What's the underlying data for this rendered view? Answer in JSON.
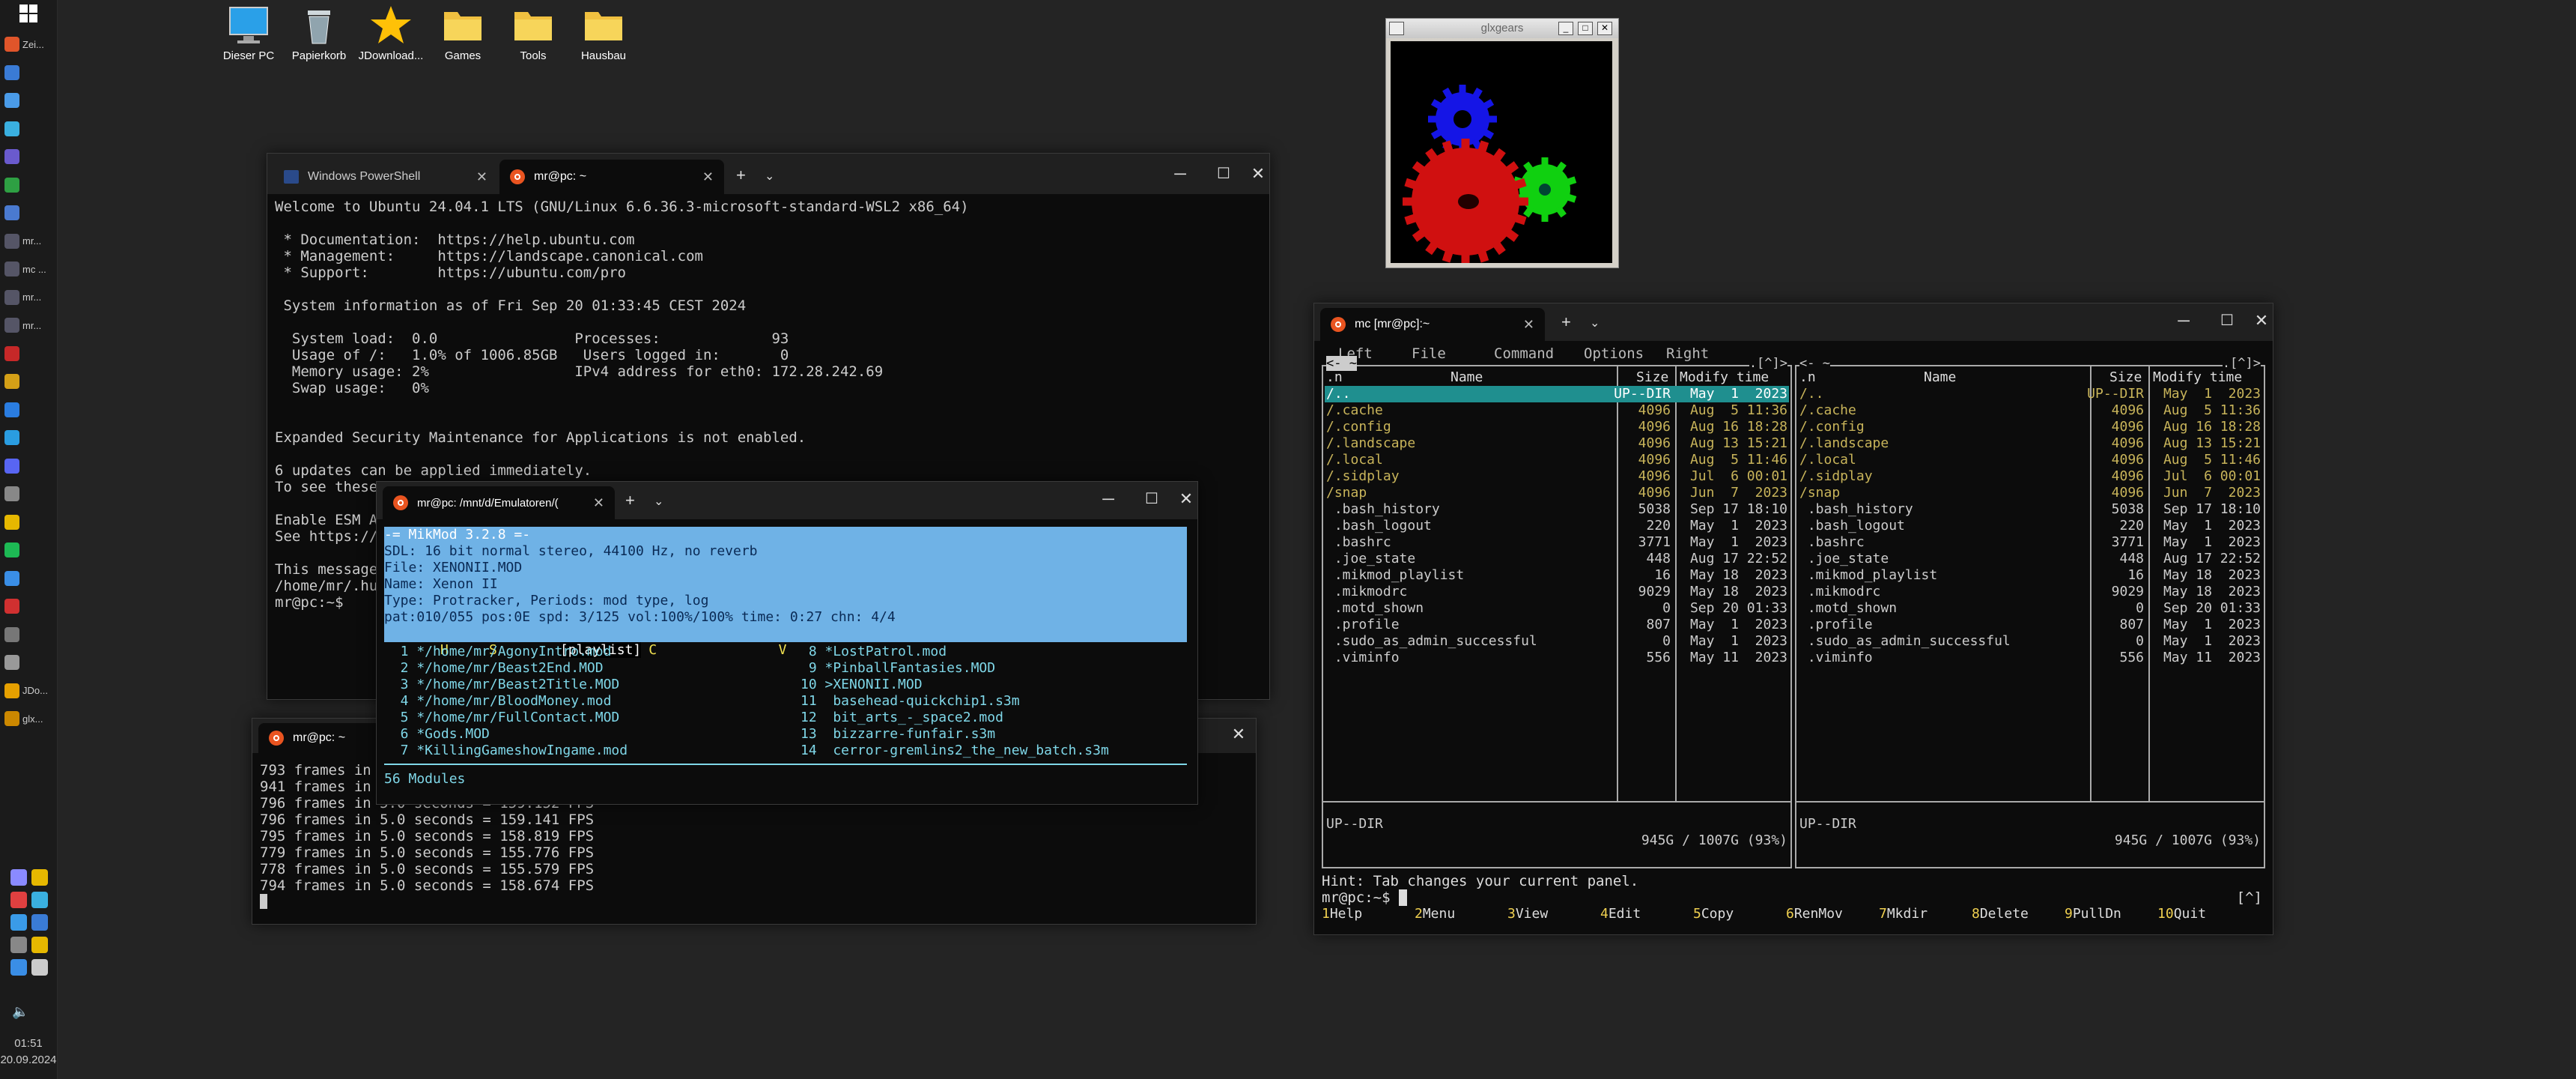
{
  "taskbar": {
    "items": [
      {
        "label": "Zei...",
        "color": "#e0552a"
      },
      {
        "label": "",
        "color": "#3a7bd5"
      },
      {
        "label": "",
        "color": "#4a9be8"
      },
      {
        "label": "",
        "color": "#3ab0e0"
      },
      {
        "label": "",
        "color": "#6a5acd"
      },
      {
        "label": "",
        "color": "#2ea043"
      },
      {
        "label": "",
        "color": "#4a7ad0"
      },
      {
        "label": "mr...",
        "color": "#556"
      },
      {
        "label": "mc ...",
        "color": "#556"
      },
      {
        "label": "mr...",
        "color": "#556"
      },
      {
        "label": "mr...",
        "color": "#556"
      },
      {
        "label": "",
        "color": "#c62828"
      },
      {
        "label": "",
        "color": "#d4a017"
      },
      {
        "label": "",
        "color": "#2a7de1"
      },
      {
        "label": "",
        "color": "#2a9de1"
      },
      {
        "label": "",
        "color": "#5865f2"
      },
      {
        "label": "",
        "color": "#888"
      },
      {
        "label": "",
        "color": "#e6b800"
      },
      {
        "label": "",
        "color": "#1db954"
      },
      {
        "label": "",
        "color": "#3a8ee6"
      },
      {
        "label": "",
        "color": "#d03030"
      },
      {
        "label": "",
        "color": "#777"
      },
      {
        "label": "",
        "color": "#999"
      },
      {
        "label": "JDo...",
        "color": "#e6a000"
      },
      {
        "label": "glx...",
        "color": "#cc8800"
      }
    ],
    "clock_time": "01:51",
    "clock_date": "20.09.2024"
  },
  "desktop_icons": [
    {
      "label": "Dieser PC",
      "icon": "monitor-icon"
    },
    {
      "label": "Papierkorb",
      "icon": "recycle-bin-icon"
    },
    {
      "label": "JDownload...",
      "icon": "star-icon"
    },
    {
      "label": "Games",
      "icon": "folder-icon"
    },
    {
      "label": "Tools",
      "icon": "folder-icon"
    },
    {
      "label": "Hausbau",
      "icon": "folder-icon"
    }
  ],
  "glxgears": {
    "title": "glxgears",
    "min": "_",
    "max": "□",
    "close": "✕"
  },
  "term1": {
    "tab1": "Windows PowerShell",
    "tab2": "mr@pc: ~",
    "lines": [
      "Welcome to Ubuntu 24.04.1 LTS (GNU/Linux 6.6.36.3-microsoft-standard-WSL2 x86_64)",
      "",
      " * Documentation:  https://help.ubuntu.com",
      " * Management:     https://landscape.canonical.com",
      " * Support:        https://ubuntu.com/pro",
      "",
      " System information as of Fri Sep 20 01:33:45 CEST 2024",
      "",
      "  System load:  0.0                Processes:             93",
      "  Usage of /:   1.0% of 1006.85GB   Users logged in:       0",
      "  Memory usage: 2%                 IPv4 address for eth0: 172.28.242.69",
      "  Swap usage:   0%",
      "",
      "",
      "Expanded Security Maintenance for Applications is not enabled.",
      "",
      "6 updates can be applied immediately.",
      "To see these",
      "",
      "Enable ESM Ap",
      "See https://u",
      "",
      "This message",
      "/home/mr/.hus",
      "mr@pc:~$"
    ]
  },
  "term2": {
    "tab": "mr@pc: ~",
    "lines": [
      "793 frames in 5",
      "941 frames in 5",
      "796 frames in 5.0 seconds = 159.152 FPS",
      "796 frames in 5.0 seconds = 159.141 FPS",
      "795 frames in 5.0 seconds = 158.819 FPS",
      "779 frames in 5.0 seconds = 155.776 FPS",
      "778 frames in 5.0 seconds = 155.579 FPS",
      "794 frames in 5.0 seconds = 158.674 FPS"
    ]
  },
  "mikmod": {
    "tab": "mr@pc: /mnt/d/Emulatoren/(",
    "header_lines": [
      "-= MikMod 3.2.8 =-",
      "SDL: 16 bit normal stereo, 44100 Hz, no reverb",
      "File: XENONII.MOD",
      "Name: Xenon II",
      "Type: Protracker, Periods: mod type, log",
      "pat:010/055 pos:0E spd: 3/125 vol:100%/100% time: 0:27 chn: 4/4"
    ],
    "menu_left": "H     S",
    "menu_active": "[playlist]",
    "menu_right": "C               V",
    "playlist_left": [
      "  1 */home/mr/AgonyIntro.mod",
      "  2 */home/mr/Beast2End.MOD",
      "  3 */home/mr/Beast2Title.MOD",
      "  4 */home/mr/BloodMoney.mod",
      "  5 */home/mr/FullContact.MOD",
      "  6 *Gods.MOD",
      "  7 *KillingGameshowIngame.mod"
    ],
    "playlist_right": [
      " 8 *LostPatrol.mod",
      " 9 *PinballFantasies.MOD",
      "10 >XENONII.MOD",
      "11  basehead-quickchip1.s3m",
      "12  bit_arts_-_space2.mod",
      "13  bizzarre-funfair.s3m",
      "14  cerror-gremlins2_the_new_batch.s3m"
    ],
    "footer": "56 Modules"
  },
  "mc": {
    "tab": "mc [mr@pc]:~",
    "menu": [
      "Left",
      "File",
      "Command",
      "Options",
      "Right"
    ],
    "left_path": "<- ~ ",
    "right_path": "<- ~ ",
    "corner": ".[^]>",
    "headers": {
      "n": ".n",
      "name": "Name",
      "size": "Size",
      "modify": "Modify time"
    },
    "files": [
      {
        "name": "/..",
        "size": "UP--DIR",
        "mod": "May  1  2023",
        "dir": true
      },
      {
        "name": "/.cache",
        "size": "4096",
        "mod": "Aug  5 11:36",
        "dir": true
      },
      {
        "name": "/.config",
        "size": "4096",
        "mod": "Aug 16 18:28",
        "dir": true
      },
      {
        "name": "/.landscape",
        "size": "4096",
        "mod": "Aug 13 15:21",
        "dir": true
      },
      {
        "name": "/.local",
        "size": "4096",
        "mod": "Aug  5 11:46",
        "dir": true
      },
      {
        "name": "/.sidplay",
        "size": "4096",
        "mod": "Jul  6 00:01",
        "dir": true
      },
      {
        "name": "/snap",
        "size": "4096",
        "mod": "Jun  7  2023",
        "dir": true
      },
      {
        "name": " .bash_history",
        "size": "5038",
        "mod": "Sep 17 18:10",
        "dir": false
      },
      {
        "name": " .bash_logout",
        "size": "220",
        "mod": "May  1  2023",
        "dir": false
      },
      {
        "name": " .bashrc",
        "size": "3771",
        "mod": "May  1  2023",
        "dir": false
      },
      {
        "name": " .joe_state",
        "size": "448",
        "mod": "Aug 17 22:52",
        "dir": false
      },
      {
        "name": " .mikmod_playlist",
        "size": "16",
        "mod": "May 18  2023",
        "dir": false
      },
      {
        "name": " .mikmodrc",
        "size": "9029",
        "mod": "May 18  2023",
        "dir": false
      },
      {
        "name": " .motd_shown",
        "size": "0",
        "mod": "Sep 20 01:33",
        "dir": false
      },
      {
        "name": " .profile",
        "size": "807",
        "mod": "May  1  2023",
        "dir": false
      },
      {
        "name": " .sudo_as_admin_successful",
        "size": "0",
        "mod": "May  1  2023",
        "dir": false
      },
      {
        "name": " .viminfo",
        "size": "556",
        "mod": "May 11  2023",
        "dir": false
      }
    ],
    "status": "UP--DIR",
    "disk": "945G / 1007G (93%)",
    "hint": "Hint: Tab changes your current panel.",
    "prompt": "mr@pc:~$",
    "prompt_corner": "[^]",
    "fkeys": [
      {
        "n": "1",
        "l": "Help"
      },
      {
        "n": "2",
        "l": "Menu"
      },
      {
        "n": "3",
        "l": "View"
      },
      {
        "n": "4",
        "l": "Edit"
      },
      {
        "n": "5",
        "l": "Copy"
      },
      {
        "n": "6",
        "l": "RenMov"
      },
      {
        "n": "7",
        "l": "Mkdir"
      },
      {
        "n": "8",
        "l": "Delete"
      },
      {
        "n": "9",
        "l": "PullDn"
      },
      {
        "n": "10",
        "l": "Quit"
      }
    ]
  },
  "colors": {
    "mc_blue_bg": "#0c0c0c",
    "mc_dir": "#c8b45a",
    "mc_cursor": "#1f8f8f",
    "mm_header": "#6fb2e6",
    "mm_text": "#7fd7e8"
  }
}
